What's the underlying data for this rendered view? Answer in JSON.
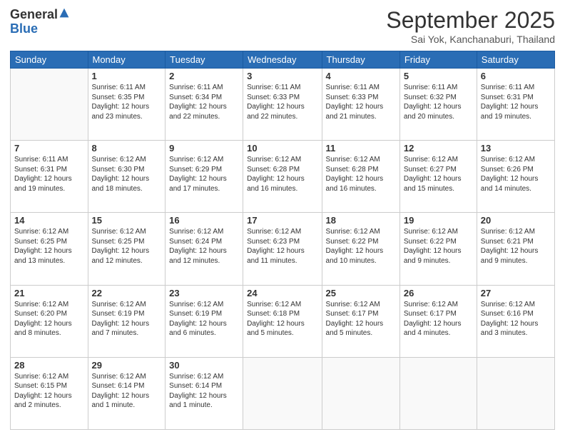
{
  "logo": {
    "line1": "General",
    "line2": "Blue"
  },
  "title": "September 2025",
  "location": "Sai Yok, Kanchanaburi, Thailand",
  "days_of_week": [
    "Sunday",
    "Monday",
    "Tuesday",
    "Wednesday",
    "Thursday",
    "Friday",
    "Saturday"
  ],
  "weeks": [
    [
      {
        "day": "",
        "sunrise": "",
        "sunset": "",
        "daylight": ""
      },
      {
        "day": "1",
        "sunrise": "6:11 AM",
        "sunset": "6:35 PM",
        "daylight": "12 hours and 23 minutes."
      },
      {
        "day": "2",
        "sunrise": "6:11 AM",
        "sunset": "6:34 PM",
        "daylight": "12 hours and 22 minutes."
      },
      {
        "day": "3",
        "sunrise": "6:11 AM",
        "sunset": "6:33 PM",
        "daylight": "12 hours and 22 minutes."
      },
      {
        "day": "4",
        "sunrise": "6:11 AM",
        "sunset": "6:33 PM",
        "daylight": "12 hours and 21 minutes."
      },
      {
        "day": "5",
        "sunrise": "6:11 AM",
        "sunset": "6:32 PM",
        "daylight": "12 hours and 20 minutes."
      },
      {
        "day": "6",
        "sunrise": "6:11 AM",
        "sunset": "6:31 PM",
        "daylight": "12 hours and 19 minutes."
      }
    ],
    [
      {
        "day": "7",
        "sunrise": "6:11 AM",
        "sunset": "6:31 PM",
        "daylight": "12 hours and 19 minutes."
      },
      {
        "day": "8",
        "sunrise": "6:12 AM",
        "sunset": "6:30 PM",
        "daylight": "12 hours and 18 minutes."
      },
      {
        "day": "9",
        "sunrise": "6:12 AM",
        "sunset": "6:29 PM",
        "daylight": "12 hours and 17 minutes."
      },
      {
        "day": "10",
        "sunrise": "6:12 AM",
        "sunset": "6:28 PM",
        "daylight": "12 hours and 16 minutes."
      },
      {
        "day": "11",
        "sunrise": "6:12 AM",
        "sunset": "6:28 PM",
        "daylight": "12 hours and 16 minutes."
      },
      {
        "day": "12",
        "sunrise": "6:12 AM",
        "sunset": "6:27 PM",
        "daylight": "12 hours and 15 minutes."
      },
      {
        "day": "13",
        "sunrise": "6:12 AM",
        "sunset": "6:26 PM",
        "daylight": "12 hours and 14 minutes."
      }
    ],
    [
      {
        "day": "14",
        "sunrise": "6:12 AM",
        "sunset": "6:25 PM",
        "daylight": "12 hours and 13 minutes."
      },
      {
        "day": "15",
        "sunrise": "6:12 AM",
        "sunset": "6:25 PM",
        "daylight": "12 hours and 12 minutes."
      },
      {
        "day": "16",
        "sunrise": "6:12 AM",
        "sunset": "6:24 PM",
        "daylight": "12 hours and 12 minutes."
      },
      {
        "day": "17",
        "sunrise": "6:12 AM",
        "sunset": "6:23 PM",
        "daylight": "12 hours and 11 minutes."
      },
      {
        "day": "18",
        "sunrise": "6:12 AM",
        "sunset": "6:22 PM",
        "daylight": "12 hours and 10 minutes."
      },
      {
        "day": "19",
        "sunrise": "6:12 AM",
        "sunset": "6:22 PM",
        "daylight": "12 hours and 9 minutes."
      },
      {
        "day": "20",
        "sunrise": "6:12 AM",
        "sunset": "6:21 PM",
        "daylight": "12 hours and 9 minutes."
      }
    ],
    [
      {
        "day": "21",
        "sunrise": "6:12 AM",
        "sunset": "6:20 PM",
        "daylight": "12 hours and 8 minutes."
      },
      {
        "day": "22",
        "sunrise": "6:12 AM",
        "sunset": "6:19 PM",
        "daylight": "12 hours and 7 minutes."
      },
      {
        "day": "23",
        "sunrise": "6:12 AM",
        "sunset": "6:19 PM",
        "daylight": "12 hours and 6 minutes."
      },
      {
        "day": "24",
        "sunrise": "6:12 AM",
        "sunset": "6:18 PM",
        "daylight": "12 hours and 5 minutes."
      },
      {
        "day": "25",
        "sunrise": "6:12 AM",
        "sunset": "6:17 PM",
        "daylight": "12 hours and 5 minutes."
      },
      {
        "day": "26",
        "sunrise": "6:12 AM",
        "sunset": "6:17 PM",
        "daylight": "12 hours and 4 minutes."
      },
      {
        "day": "27",
        "sunrise": "6:12 AM",
        "sunset": "6:16 PM",
        "daylight": "12 hours and 3 minutes."
      }
    ],
    [
      {
        "day": "28",
        "sunrise": "6:12 AM",
        "sunset": "6:15 PM",
        "daylight": "12 hours and 2 minutes."
      },
      {
        "day": "29",
        "sunrise": "6:12 AM",
        "sunset": "6:14 PM",
        "daylight": "12 hours and 1 minute."
      },
      {
        "day": "30",
        "sunrise": "6:12 AM",
        "sunset": "6:14 PM",
        "daylight": "12 hours and 1 minute."
      },
      {
        "day": "",
        "sunrise": "",
        "sunset": "",
        "daylight": ""
      },
      {
        "day": "",
        "sunrise": "",
        "sunset": "",
        "daylight": ""
      },
      {
        "day": "",
        "sunrise": "",
        "sunset": "",
        "daylight": ""
      },
      {
        "day": "",
        "sunrise": "",
        "sunset": "",
        "daylight": ""
      }
    ]
  ]
}
